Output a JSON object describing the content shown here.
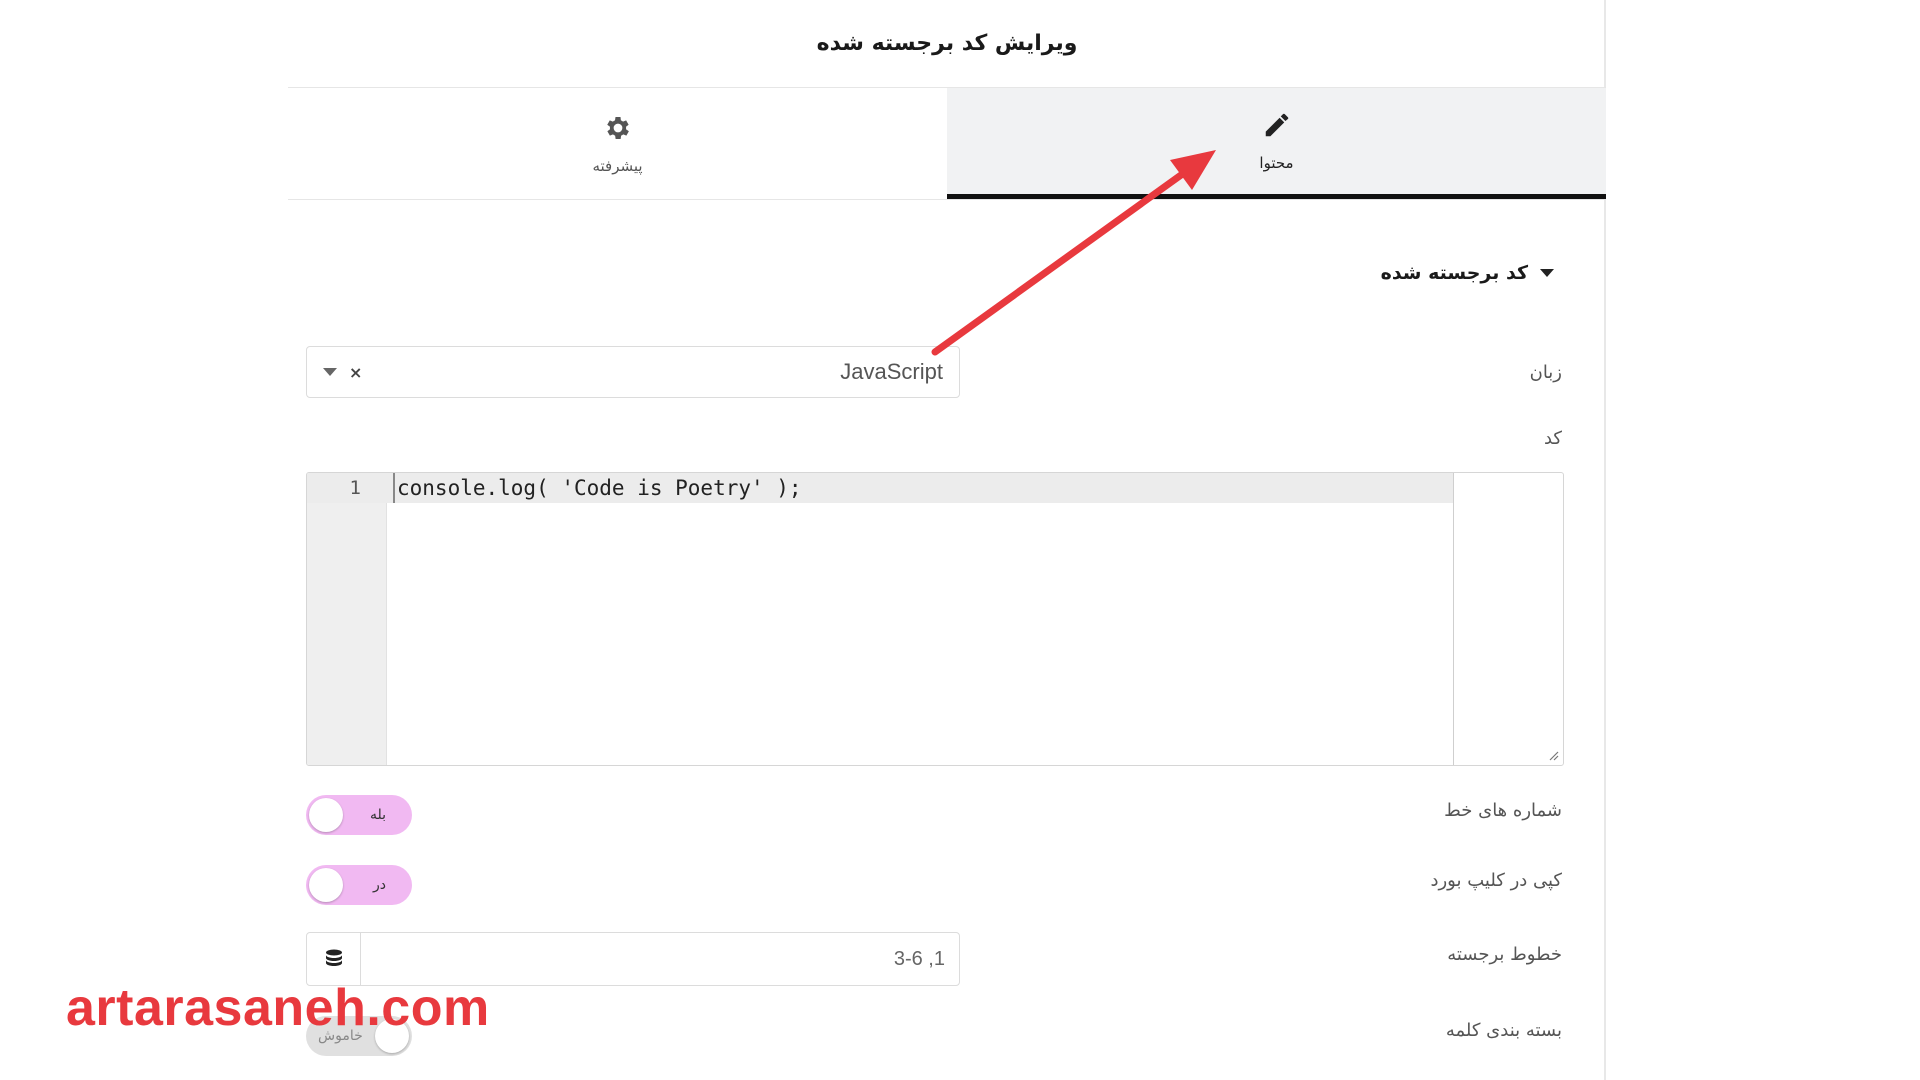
{
  "panel": {
    "title": "ویرایش کد برجسته شده"
  },
  "tabs": [
    {
      "label": "محتوا",
      "icon": "pencil-icon",
      "active": true
    },
    {
      "label": "پیشرفته",
      "icon": "gear-icon",
      "active": false
    }
  ],
  "section": {
    "title": "کد برجسته شده"
  },
  "language": {
    "label": "زبان",
    "value": "JavaScript"
  },
  "code": {
    "label": "کد",
    "lines": [
      {
        "number": "1",
        "text": "console.log( 'Code is Poetry' );"
      }
    ]
  },
  "line_numbers": {
    "label": "شماره های خط",
    "toggle_text": "بله"
  },
  "copy_clipboard": {
    "label": "کپی در کلیپ بورد",
    "toggle_text": "در"
  },
  "highlight_lines": {
    "label": "خطوط برجسته",
    "placeholder": "1, 3-6"
  },
  "word_wrap": {
    "label": "بسته بندی کلمه",
    "toggle_text": "خاموش"
  },
  "watermark": {
    "text": "artarasaneh.com"
  },
  "colors": {
    "toggle_on": "#f1b9f2",
    "arrow": "#e8393e",
    "active_tab_border": "#111111"
  }
}
